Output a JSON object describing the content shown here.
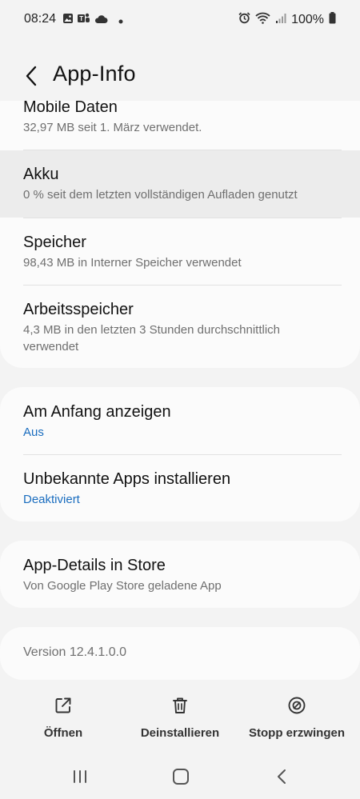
{
  "status": {
    "time": "08:24",
    "battery": "100%",
    "left_icons": [
      "gallery-icon",
      "teams-icon",
      "cloud-icon",
      "dot-icon"
    ],
    "right_icons": [
      "alarm-icon",
      "wifi-icon",
      "signal-icon",
      "battery-icon"
    ]
  },
  "header": {
    "title": "App-Info",
    "back_icon": "back-arrow-icon"
  },
  "sections": {
    "usage": {
      "mobile_data": {
        "title": "Mobile Daten",
        "subtitle": "32,97 MB seit 1. März verwendet."
      },
      "battery": {
        "title": "Akku",
        "subtitle": "0 % seit dem letzten vollständigen Aufladen genutzt"
      },
      "storage": {
        "title": "Speicher",
        "subtitle": "98,43 MB in Interner Speicher verwendet"
      },
      "memory": {
        "title": "Arbeitsspeicher",
        "subtitle_line1": "4,3 MB in den letzten 3 Stunden durchschnittlich",
        "subtitle_line2": "verwendet"
      }
    },
    "settings": {
      "appear_on_top": {
        "title": "Am Anfang anzeigen",
        "value": "Aus"
      },
      "unknown_apps": {
        "title": "Unbekannte Apps installieren",
        "value": "Deaktiviert"
      }
    },
    "store": {
      "details": {
        "title": "App-Details in Store",
        "subtitle": "Von Google Play Store geladene App"
      }
    },
    "version": {
      "text": "Version 12.4.1.0.0"
    }
  },
  "actions": {
    "open": {
      "label": "Öffnen",
      "icon": "open-external-icon"
    },
    "uninstall": {
      "label": "Deinstallieren",
      "icon": "trash-icon"
    },
    "force_stop": {
      "label": "Stopp erzwingen",
      "icon": "stop-icon"
    }
  },
  "nav": {
    "recents_icon": "recents-icon",
    "home_icon": "home-icon",
    "back_icon": "nav-back-icon"
  },
  "colors": {
    "background": "#f3f3f3",
    "card": "#fbfbfb",
    "accent_blue": "#1a6dbf",
    "secondary_text": "#6f6f6f"
  }
}
